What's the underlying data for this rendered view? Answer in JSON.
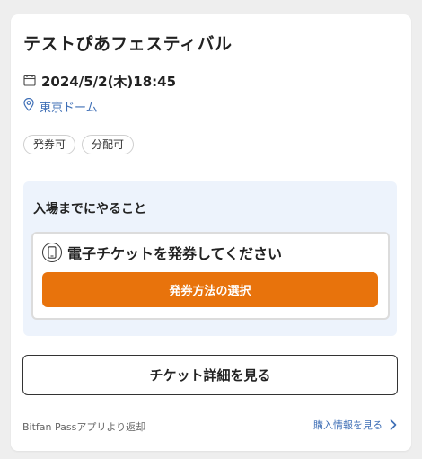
{
  "event": {
    "title": "テストぴあフェスティバル",
    "datetime": "2024/5/2(木)18:45",
    "venue": "東京ドーム",
    "badges": [
      "発券可",
      "分配可"
    ]
  },
  "todo": {
    "title": "入場までにやること",
    "item_text": "電子チケットを発券してください",
    "button_label": "発券方法の選択"
  },
  "detail_button": "チケット詳細を見る",
  "footer": {
    "source_text": "Bitfan Passアプリより返却",
    "purchase_link": "購入情報を見る"
  },
  "colors": {
    "accent_orange": "#e8730c",
    "link_blue": "#3f6fb6",
    "todo_bg": "#edf3fc"
  },
  "icons": {
    "date": "calendar-icon",
    "venue": "location-pin-icon",
    "ticket": "smartphone-icon",
    "link": "chevron-right-icon"
  }
}
